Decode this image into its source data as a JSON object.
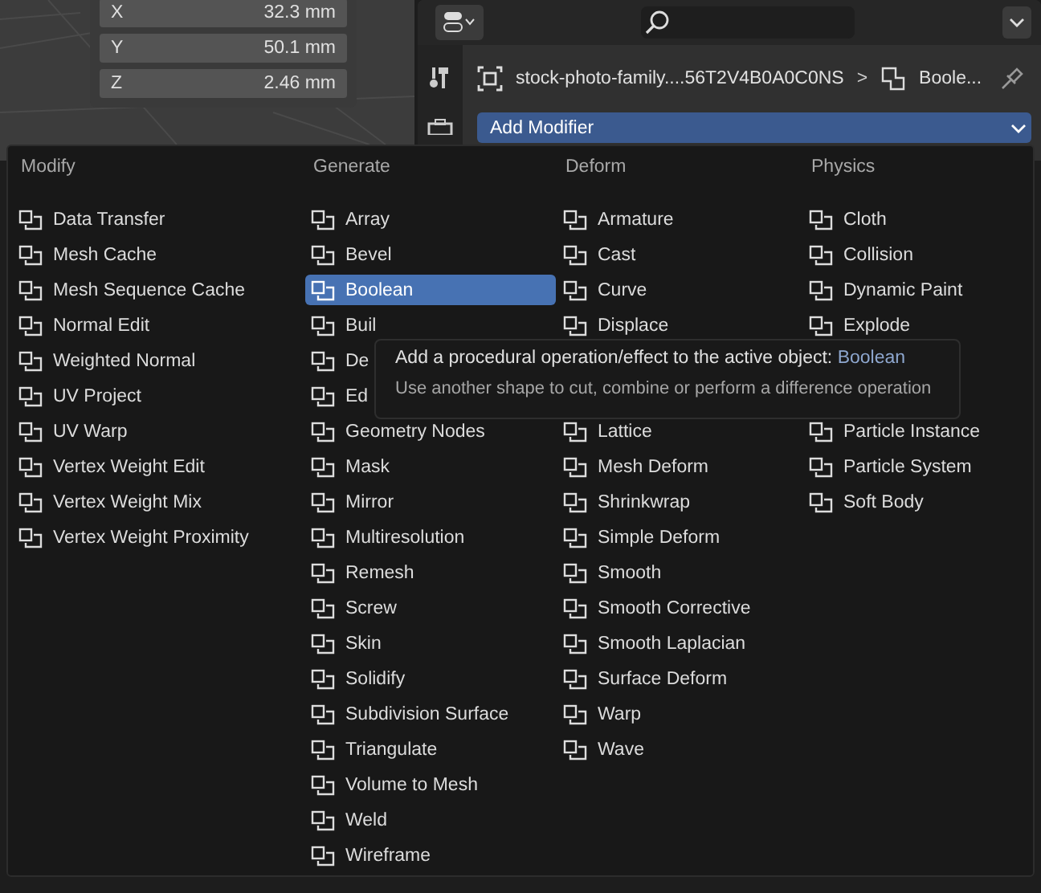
{
  "transform_panel": {
    "rows": [
      {
        "axis": "X",
        "value": "32.3 mm"
      },
      {
        "axis": "Y",
        "value": "50.1 mm"
      },
      {
        "axis": "Z",
        "value": "2.46 mm"
      }
    ]
  },
  "properties": {
    "breadcrumb": {
      "object": "stock-photo-family....56T2V4B0A0C0NS",
      "separator": ">",
      "modifier": "Boole..."
    },
    "add_modifier": {
      "label": "Add Modifier",
      "expanded": true
    }
  },
  "menu": {
    "columns": [
      {
        "title": "Modify",
        "sections": [
          [
            {
              "label": "Data Transfer",
              "selected": false
            },
            {
              "label": "Mesh Cache",
              "selected": false
            },
            {
              "label": "Mesh Sequence Cache",
              "selected": false
            },
            {
              "label": "Normal Edit",
              "selected": false
            },
            {
              "label": "Weighted Normal",
              "selected": false
            },
            {
              "label": "UV Project",
              "selected": false
            },
            {
              "label": "UV Warp",
              "selected": false
            },
            {
              "label": "Vertex Weight Edit",
              "selected": false
            },
            {
              "label": "Vertex Weight Mix",
              "selected": false
            },
            {
              "label": "Vertex Weight Proximity",
              "selected": false
            }
          ]
        ]
      },
      {
        "title": "Generate",
        "sections": [
          [
            {
              "label": "Array",
              "selected": false
            },
            {
              "label": "Bevel",
              "selected": false
            },
            {
              "label": "Boolean",
              "selected": true
            },
            {
              "label": "Buil",
              "selected": false
            },
            {
              "label": "De",
              "selected": false
            },
            {
              "label": "Ed",
              "selected": false
            },
            {
              "label": "Geometry Nodes",
              "selected": false
            },
            {
              "label": "Mask",
              "selected": false
            },
            {
              "label": "Mirror",
              "selected": false
            },
            {
              "label": "Multiresolution",
              "selected": false
            },
            {
              "label": "Remesh",
              "selected": false
            },
            {
              "label": "Screw",
              "selected": false
            },
            {
              "label": "Skin",
              "selected": false
            },
            {
              "label": "Solidify",
              "selected": false
            },
            {
              "label": "Subdivision Surface",
              "selected": false
            },
            {
              "label": "Triangulate",
              "selected": false
            },
            {
              "label": "Volume to Mesh",
              "selected": false
            },
            {
              "label": "Weld",
              "selected": false
            },
            {
              "label": "Wireframe",
              "selected": false
            }
          ]
        ]
      },
      {
        "title": "Deform",
        "sections": [
          [
            {
              "label": "Armature",
              "selected": false
            },
            {
              "label": "Cast",
              "selected": false
            },
            {
              "label": "Curve",
              "selected": false
            },
            {
              "label": "Displace",
              "selected": false
            }
          ],
          [
            {
              "label": "Lattice",
              "selected": false
            },
            {
              "label": "Mesh Deform",
              "selected": false
            },
            {
              "label": "Shrinkwrap",
              "selected": false
            },
            {
              "label": "Simple Deform",
              "selected": false
            },
            {
              "label": "Smooth",
              "selected": false
            },
            {
              "label": "Smooth Corrective",
              "selected": false
            },
            {
              "label": "Smooth Laplacian",
              "selected": false
            },
            {
              "label": "Surface Deform",
              "selected": false
            },
            {
              "label": "Warp",
              "selected": false
            },
            {
              "label": "Wave",
              "selected": false
            }
          ]
        ]
      },
      {
        "title": "Physics",
        "sections": [
          [
            {
              "label": "Cloth",
              "selected": false
            },
            {
              "label": "Collision",
              "selected": false
            },
            {
              "label": "Dynamic Paint",
              "selected": false
            },
            {
              "label": "Explode",
              "selected": false
            }
          ],
          [
            {
              "label": "Particle Instance",
              "selected": false
            },
            {
              "label": "Particle System",
              "selected": false
            },
            {
              "label": "Soft Body",
              "selected": false
            }
          ]
        ]
      }
    ]
  },
  "tooltip": {
    "text": "Add a procedural operation/effect to the active object:",
    "highlight": "Boolean",
    "description": "Use another shape to cut, combine or perform a difference operation"
  }
}
